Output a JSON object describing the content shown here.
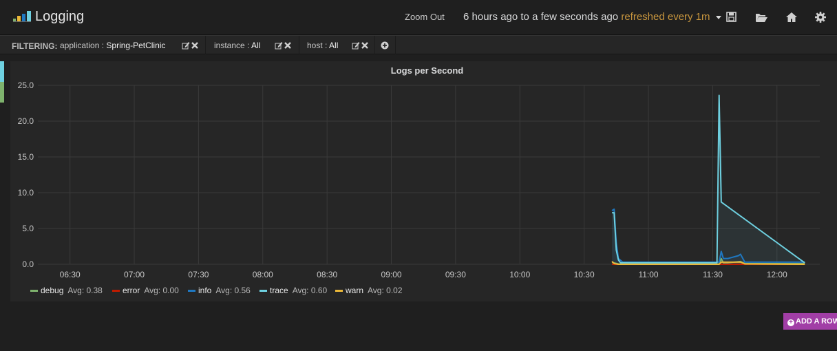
{
  "header": {
    "title": "Logging",
    "zoom_out": "Zoom Out",
    "time_range": "6 hours ago to a few seconds ago",
    "refresh": "refreshed every 1m",
    "icons": [
      "save-icon",
      "folder-open-icon",
      "home-icon",
      "gear-icon"
    ]
  },
  "filtering": {
    "label": "FILTERING:",
    "filters": [
      {
        "key": "application",
        "value": "Spring-PetClinic"
      },
      {
        "key": "instance",
        "value": "All"
      },
      {
        "key": "host",
        "value": "All"
      }
    ]
  },
  "colors": {
    "debug": "#7eb26d",
    "error": "#bf1b00",
    "info": "#1f78c1",
    "trace": "#6ed0e0",
    "warn": "#eab839",
    "add_row": "#a13ea6",
    "refresh": "#c8963e"
  },
  "panel": {
    "title": "Logs per Second"
  },
  "chart_data": {
    "type": "line",
    "title": "Logs per Second",
    "ylim": [
      0,
      25
    ],
    "yticks": [
      "0.0",
      "5.0",
      "10.0",
      "15.0",
      "20.0",
      "25.0"
    ],
    "xlim": [
      "06:15",
      "12:20"
    ],
    "xticks": [
      "06:30",
      "07:00",
      "07:30",
      "08:00",
      "08:30",
      "09:00",
      "09:30",
      "10:00",
      "10:30",
      "11:00",
      "11:30",
      "12:00"
    ],
    "grid": true,
    "legend_position": "bottom-left",
    "series": [
      {
        "name": "debug",
        "avg": "Avg: 0.38",
        "x": [
          "10:43",
          "10:44",
          "10:46",
          "10:48",
          "11:33",
          "11:34",
          "11:35",
          "11:37",
          "11:43",
          "11:45",
          "12:13"
        ],
        "y": [
          0.3,
          0.2,
          0.05,
          0.02,
          0.02,
          0.8,
          0.2,
          0.2,
          0.4,
          0.1,
          0.1
        ]
      },
      {
        "name": "error",
        "avg": "Avg: 0.00",
        "x": [
          "10:43",
          "12:13"
        ],
        "y": [
          0.0,
          0.0
        ]
      },
      {
        "name": "info",
        "avg": "Avg: 0.56",
        "x": [
          "10:43",
          "10:44",
          "10:45",
          "10:46",
          "10:48",
          "11:33",
          "11:34",
          "11:35",
          "11:37",
          "11:42",
          "11:43",
          "11:45",
          "12:13"
        ],
        "y": [
          7.5,
          7.7,
          3.0,
          0.8,
          0.3,
          0.3,
          1.8,
          0.8,
          0.8,
          1.2,
          1.4,
          0.3,
          0.3
        ]
      },
      {
        "name": "trace",
        "avg": "Avg: 0.60",
        "x": [
          "10:43",
          "10:44",
          "10:45",
          "10:46",
          "10:47",
          "10:48",
          "11:32",
          "11:33",
          "11:33",
          "11:34",
          "12:13"
        ],
        "y": [
          7.2,
          7.2,
          2.0,
          0.6,
          0.2,
          0.2,
          0.2,
          23.6,
          23.6,
          8.7,
          0.2
        ]
      },
      {
        "name": "warn",
        "avg": "Avg: 0.02",
        "x": [
          "10:43",
          "10:44",
          "10:46",
          "11:33",
          "11:34",
          "11:43",
          "11:45",
          "12:13"
        ],
        "y": [
          0.4,
          0.1,
          0.0,
          0.0,
          0.3,
          0.3,
          0.05,
          0.0
        ]
      }
    ]
  },
  "add_row": "ADD A ROW"
}
